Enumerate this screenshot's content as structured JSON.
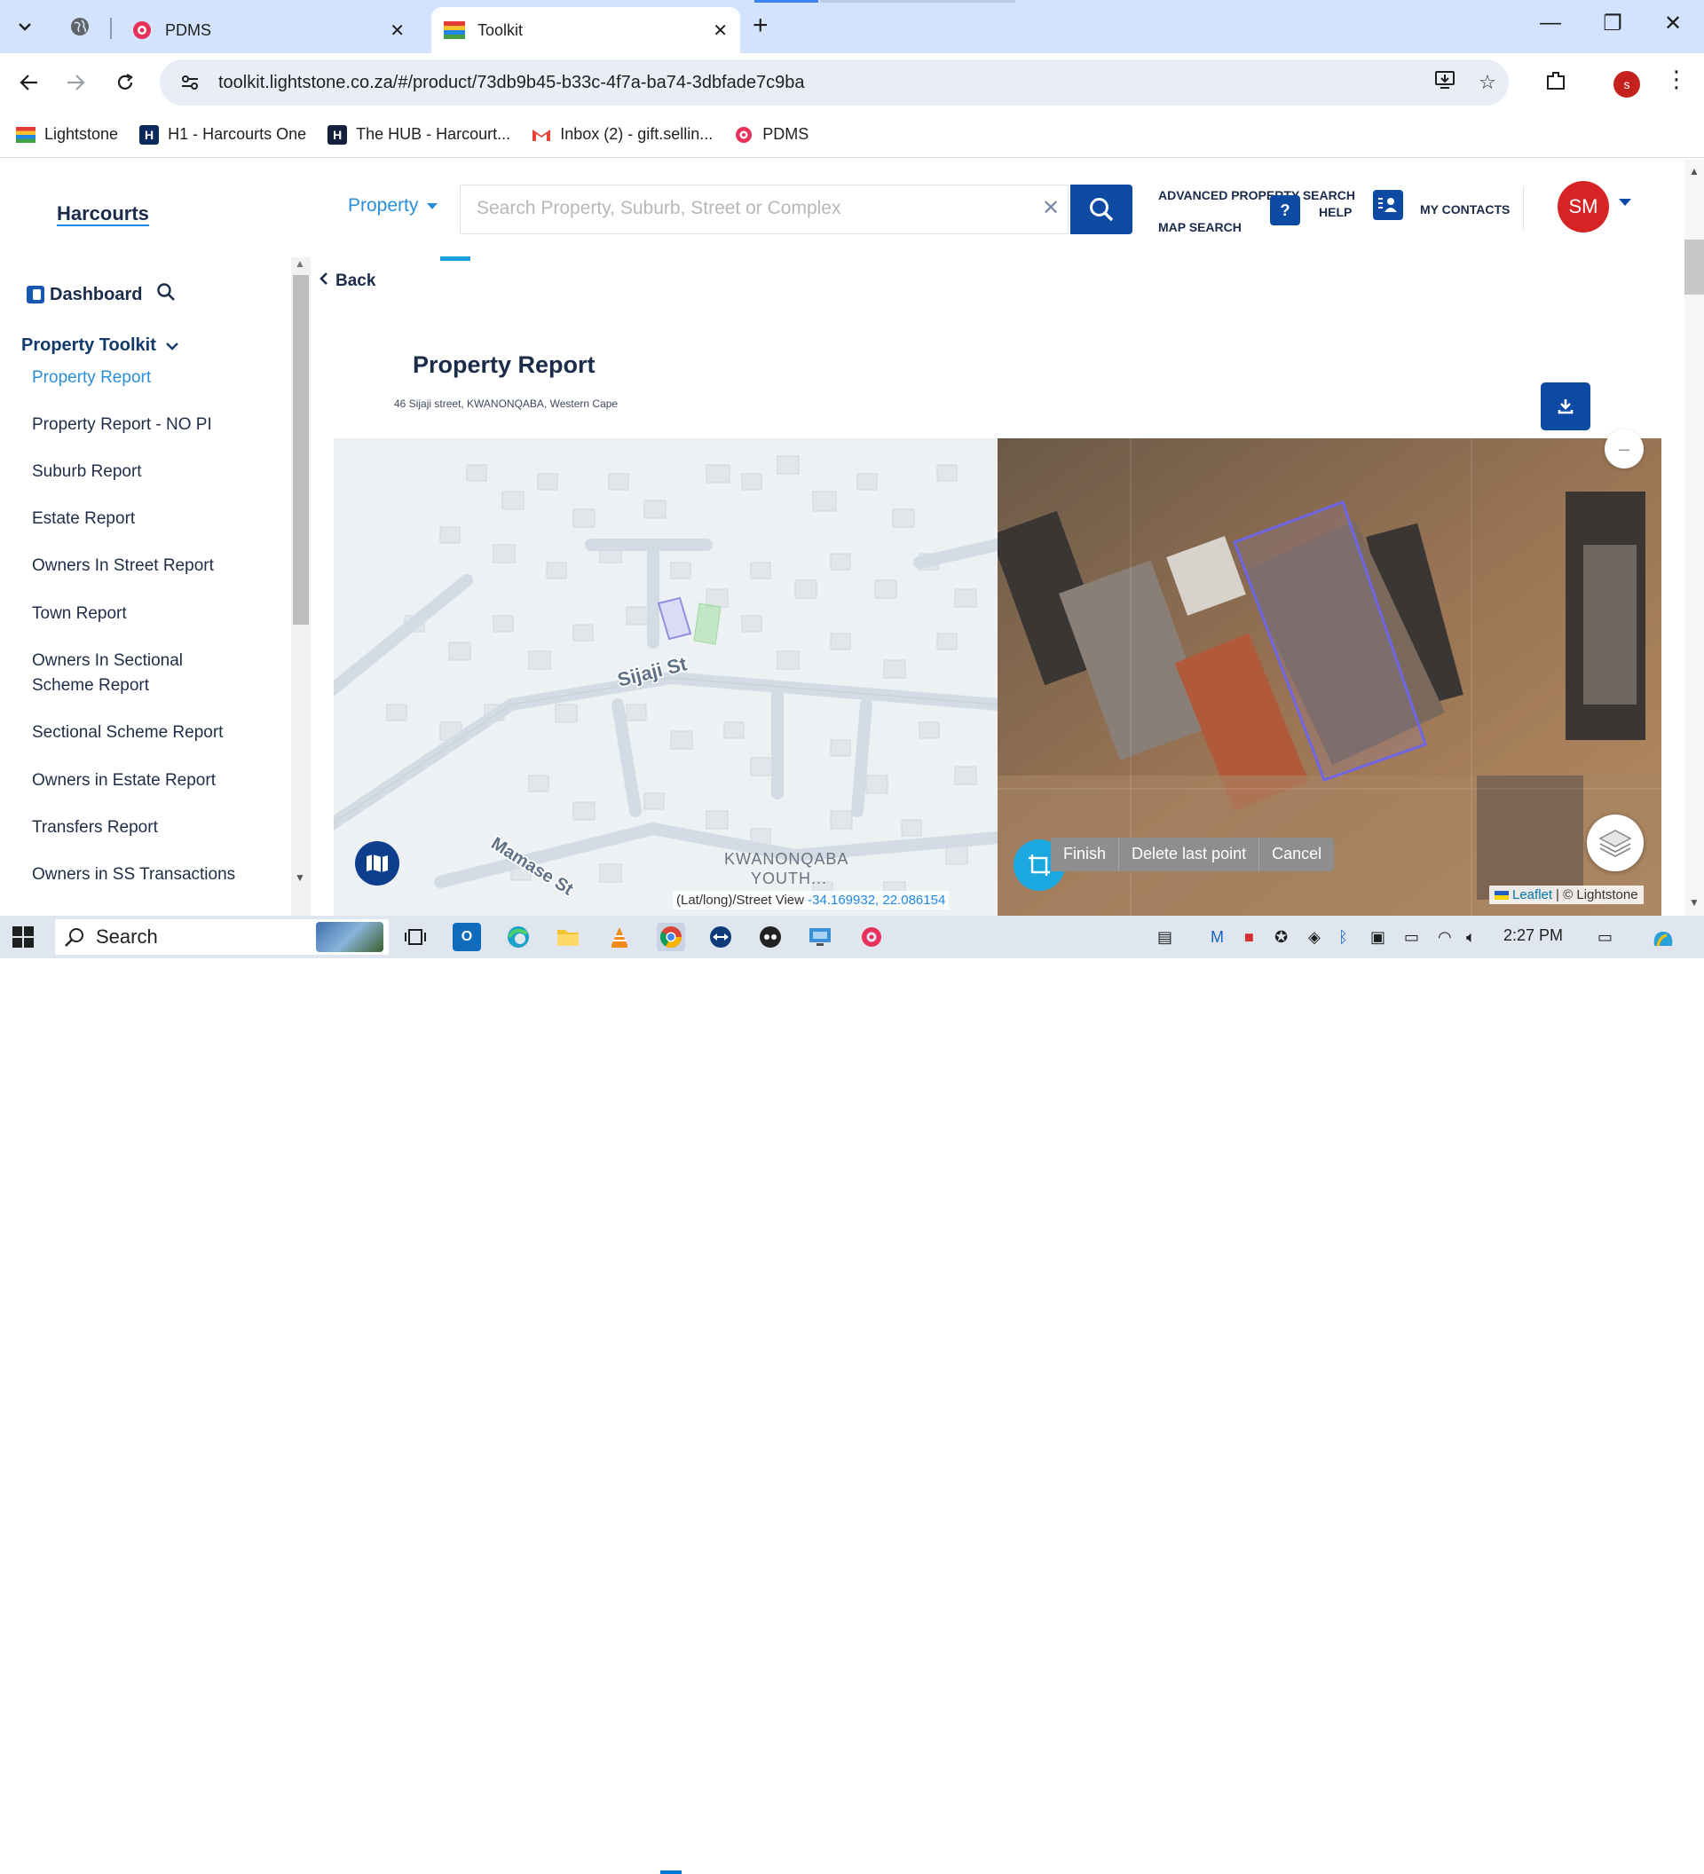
{
  "browser": {
    "tabs": [
      {
        "title": "PDMS",
        "active": false
      },
      {
        "title": "Toolkit",
        "active": true
      }
    ],
    "url": "toolkit.lightstone.co.za/#/product/73db9b45-b33c-4f7a-ba74-3dbfade7c9ba",
    "profile_initial": "s",
    "bookmarks": [
      {
        "label": "Lightstone",
        "icon": "lightstone-icon"
      },
      {
        "label": "H1 - Harcourts One",
        "icon": "harcourts-h-icon"
      },
      {
        "label": "The HUB - Harcourt...",
        "icon": "harcourts-h-dark-icon"
      },
      {
        "label": "Inbox (2) - gift.sellin...",
        "icon": "gmail-icon"
      },
      {
        "label": "PDMS",
        "icon": "pdms-icon"
      }
    ]
  },
  "app": {
    "brand": "Harcourts",
    "property_dropdown": "Property",
    "search_placeholder": "Search Property, Suburb, Street or Complex",
    "advanced_search": "ADVANCED PROPERTY SEARCH",
    "map_search": "MAP SEARCH",
    "help": "HELP",
    "help_icon_text": "?",
    "my_contacts": "MY CONTACTS",
    "avatar_initials": "SM"
  },
  "sidebar": {
    "dashboard": "Dashboard",
    "section": "Property Toolkit",
    "items": [
      {
        "label": "Property Report",
        "active": true
      },
      {
        "label": "Property Report - NO PI",
        "active": false
      },
      {
        "label": "Suburb Report",
        "active": false
      },
      {
        "label": "Estate Report",
        "active": false
      },
      {
        "label": "Owners In Street Report",
        "active": false
      },
      {
        "label": "Town Report",
        "active": false
      },
      {
        "label": "Owners In Sectional Scheme Report",
        "active": false
      },
      {
        "label": "Sectional Scheme Report",
        "active": false
      },
      {
        "label": "Owners in Estate Report",
        "active": false
      },
      {
        "label": "Transfers Report",
        "active": false
      },
      {
        "label": "Owners in SS Transactions",
        "active": false
      }
    ]
  },
  "report": {
    "back": "Back",
    "title": "Property Report",
    "address": "46 Sijaji street, KWANONQABA, Western Cape"
  },
  "map": {
    "street_labels": [
      "Sijaji St",
      "Mamase St"
    ],
    "area_label_line1": "KWANONQABA",
    "area_label_line2": "YOUTH...",
    "coord_label": "(Lat/long)/Street View",
    "coords": "-34.169932, 22.086154",
    "draw_actions": [
      "Finish",
      "Delete last point",
      "Cancel"
    ],
    "zoom_out": "–",
    "attribution_leaflet": "Leaflet",
    "attribution_rest": "| © Lightstone"
  },
  "taskbar": {
    "search": "Search",
    "time": "2:27 PM"
  }
}
